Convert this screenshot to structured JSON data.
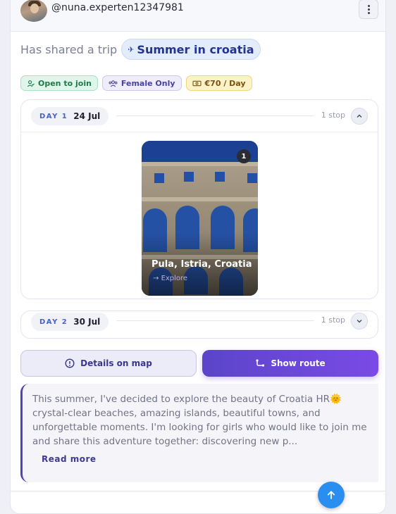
{
  "post": {
    "username": "@nuna.experten12347981",
    "shared_text": "Has shared a trip",
    "trip_name": "Summer in croatia"
  },
  "badges": [
    {
      "label": "Open to join",
      "icon": "person-check-icon"
    },
    {
      "label": "Female Only",
      "icon": "group-icon"
    },
    {
      "label": "€70 / Day",
      "icon": "money-icon"
    }
  ],
  "days": [
    {
      "label": "DAY 1",
      "date": "24 Jul",
      "stops": "1 stop",
      "expanded": true
    },
    {
      "label": "DAY 2",
      "date": "30 Jul",
      "stops": "1 stop",
      "expanded": false
    }
  ],
  "place": {
    "index": "1",
    "name": "Pula, Istria, Croatia",
    "explore": "Explore"
  },
  "actions": {
    "details_map": "Details on map",
    "show_route": "Show route"
  },
  "description": {
    "text": "This summer, I've decided to explore the beauty of Croatia HR🌞 crystal-clear beaches, amazing islands, beautiful towns, and unforgettable moments. I'm looking for girls who would like to join me and share this adventure together: discovering new p...",
    "read_more": "Read more"
  },
  "colors": {
    "accent": "#5b45c9",
    "fab": "#2a8ef0"
  }
}
